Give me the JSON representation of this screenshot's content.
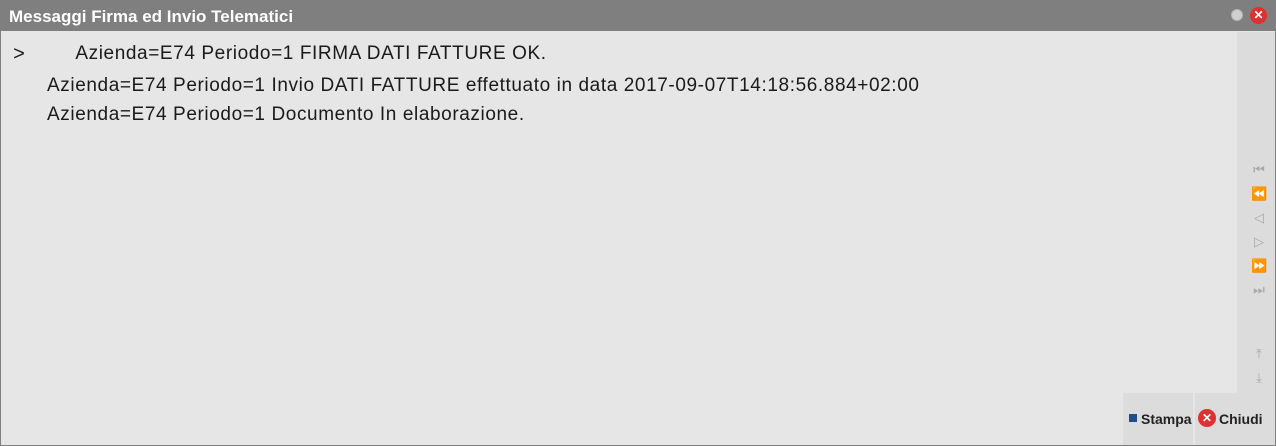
{
  "window": {
    "title": "Messaggi Firma ed Invio Telematici",
    "close_glyph": "✕"
  },
  "console": {
    "prompt": ">",
    "lines": [
      "     Azienda=E74 Periodo=1 FIRMA DATI FATTURE OK.",
      "Azienda=E74 Periodo=1 Invio DATI FATTURE effettuato in data 2017-09-07T14:18:56.884+02:00",
      "Azienda=E74 Periodo=1 Documento In elaborazione."
    ]
  },
  "nav": {
    "first": "⏮",
    "prev_page": "⏪",
    "prev": "◁",
    "next": "▷",
    "next_page": "⏩",
    "last": "⏭",
    "top": "⤒",
    "bottom": "⤓"
  },
  "buttons": {
    "stampa": "Stampa",
    "chiudi": "Chiudi",
    "chiudi_glyph": "✕"
  },
  "colors": {
    "titlebar": "#7f7f7f",
    "background": "#e6e6e6",
    "close_red": "#e03030",
    "stampa_blue": "#1e4f8a"
  }
}
